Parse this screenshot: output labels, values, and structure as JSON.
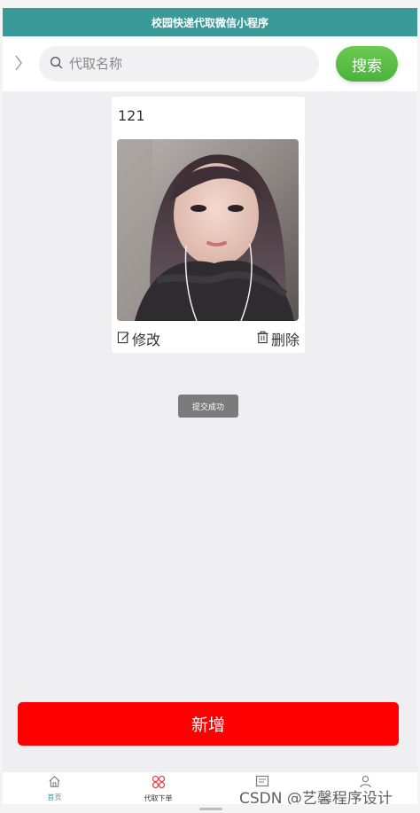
{
  "app": {
    "title": "校园快递代取微信小程序"
  },
  "search": {
    "back_icon": "chevron-right-icon",
    "search_icon": "search-icon",
    "placeholder": "代取名称",
    "value": "",
    "button_label": "搜索"
  },
  "card": {
    "title": "121",
    "photo": "portrait-photo",
    "edit_icon": "edit-icon",
    "edit_label": "修改",
    "delete_icon": "trash-icon",
    "delete_label": "删除"
  },
  "toast": {
    "text": "提交成功"
  },
  "add_button": {
    "label": "新增"
  },
  "tabbar": {
    "items": [
      {
        "label": "首页",
        "icon": "home-icon",
        "active": true
      },
      {
        "label": "代取下单",
        "icon": "grid-icon",
        "active": false
      },
      {
        "label": "",
        "icon": "message-icon",
        "active": false
      },
      {
        "label": "",
        "icon": "user-icon",
        "active": false
      }
    ]
  },
  "watermark": {
    "text": "CSDN @艺馨程序设计"
  },
  "colors": {
    "title_bar": "#3a9a9a",
    "search_button": "#4ab33d",
    "add_button": "#ff0000",
    "toast": "#7b7b7b",
    "background": "#efeff1"
  }
}
